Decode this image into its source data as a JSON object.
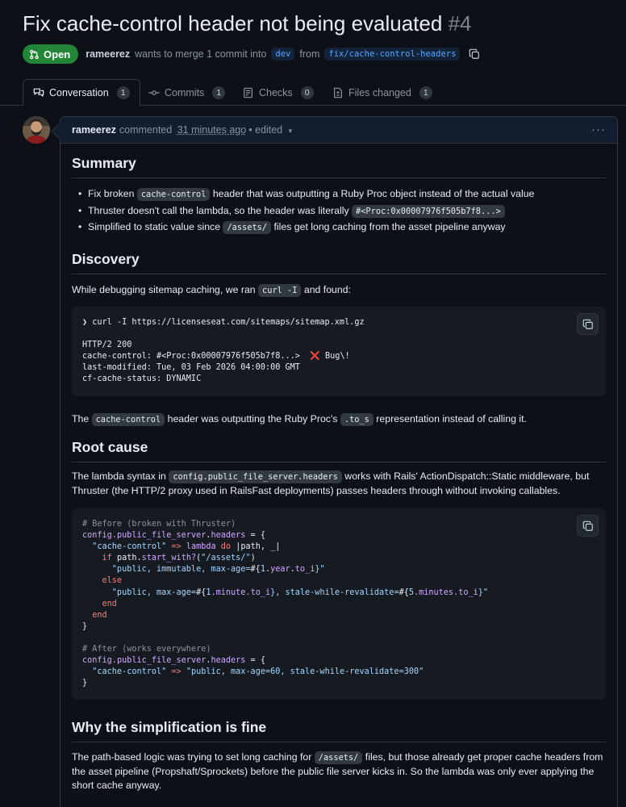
{
  "pr": {
    "title": "Fix cache-control header not being evaluated",
    "number": "#4",
    "state_label": "Open",
    "author": "rameerez",
    "merge_text_1": "wants to merge 1 commit into",
    "base_branch": "dev",
    "merge_text_2": "from",
    "head_branch": "fix/cache-control-headers"
  },
  "tabs": [
    {
      "label": "Conversation",
      "count": "1"
    },
    {
      "label": "Commits",
      "count": "1"
    },
    {
      "label": "Checks",
      "count": "0"
    },
    {
      "label": "Files changed",
      "count": "1"
    }
  ],
  "comment": {
    "author": "rameerez",
    "action": "commented",
    "time": "31 minutes ago",
    "separator": "•",
    "edited": "edited",
    "more": "···"
  },
  "summary": {
    "heading": "Summary",
    "items": [
      {
        "pre": "Fix broken ",
        "code": "cache-control",
        "post": " header that was outputting a Ruby Proc object instead of the actual value"
      },
      {
        "pre": "Thruster doesn't call the lambda, so the header was literally ",
        "code": "#<Proc:0x00007976f505b7f8...>",
        "post": ""
      },
      {
        "pre": "Simplified to static value since ",
        "code": "/assets/",
        "post": " files get long caching from the asset pipeline anyway"
      }
    ]
  },
  "discovery": {
    "heading": "Discovery",
    "intro_pre": "While debugging sitemap caching, we ran ",
    "intro_code": "curl -I",
    "intro_post": " and found:",
    "code": {
      "prompt": "❯ curl -I https://licenseseat.com/sitemaps/sitemap.xml.gz",
      "line1": "HTTP/2 200",
      "line2": "cache-control: #<Proc:0x00007976f505b7f8...>",
      "line2_mark": "❌",
      "line2_note": "Bug\\!",
      "line3": "last-modified: Tue, 03 Feb 2026 04:00:00 GMT",
      "line4": "cf-cache-status: DYNAMIC"
    },
    "outro_pre": "The ",
    "outro_code1": "cache-control",
    "outro_mid": " header was outputting the Ruby Proc's ",
    "outro_code2": ".to_s",
    "outro_post": " representation instead of calling it."
  },
  "root_cause": {
    "heading": "Root cause",
    "para_pre": "The lambda syntax in ",
    "para_code": "config.public_file_server.headers",
    "para_post": " works with Rails' ActionDispatch::Static middleware, but Thruster (the HTTP/2 proxy used in RailsFast deployments) passes headers through without invoking callables.",
    "code": {
      "c1": "# Before (broken with Thruster)",
      "c2a": "config.",
      "c2b": "public_file_server",
      "c2c": ".",
      "c2d": "headers",
      "c2e": " = {",
      "c3a": "  \"cache-control\"",
      "c3b": " => ",
      "c3c": "lambda",
      "c3d": " ",
      "c3e": "do",
      "c3f": " |path, _|",
      "c4a": "    if",
      "c4b": " path.",
      "c4c": "start_with?",
      "c4d": "(",
      "c4e": "\"/assets/\"",
      "c4f": ")",
      "c5a": "      \"public, immutable, max-age=",
      "c5b": "#{",
      "c5c": "1",
      "c5d": ".",
      "c5e": "year",
      "c5f": ".",
      "c5g": "to_i",
      "c5h": "}\"",
      "c6": "    else",
      "c7a": "      \"public, max-age=",
      "c7b": "#{",
      "c7c": "1",
      "c7d": ".minute.to_i",
      "c7e": "}, stale-while-revalidate=",
      "c7f": "#{",
      "c7g": "5",
      "c7h": ".minutes.to_i",
      "c7i": "}\"",
      "c8": "    end",
      "c9": "  end",
      "c10": "}",
      "c11": "# After (works everywhere)",
      "c12a": "config.",
      "c12b": "public_file_server",
      "c12c": ".",
      "c12d": "headers",
      "c12e": " = {",
      "c13a": "  \"cache-control\"",
      "c13b": " => ",
      "c13c": "\"public, max-age=60, stale-while-revalidate=300\"",
      "c14": "}"
    }
  },
  "why": {
    "heading": "Why the simplification is fine",
    "para_pre": "The path-based logic was trying to set long caching for ",
    "para_code": "/assets/",
    "para_post": " files, but those already get proper cache headers from the asset pipeline (Propshaft/Sprockets) before the public file server kicks in. So the lambda was only ever applying the short cache anyway."
  },
  "colors": {
    "open_green": "#238636",
    "link_blue": "#58a6ff",
    "bg": "#0d1117"
  }
}
